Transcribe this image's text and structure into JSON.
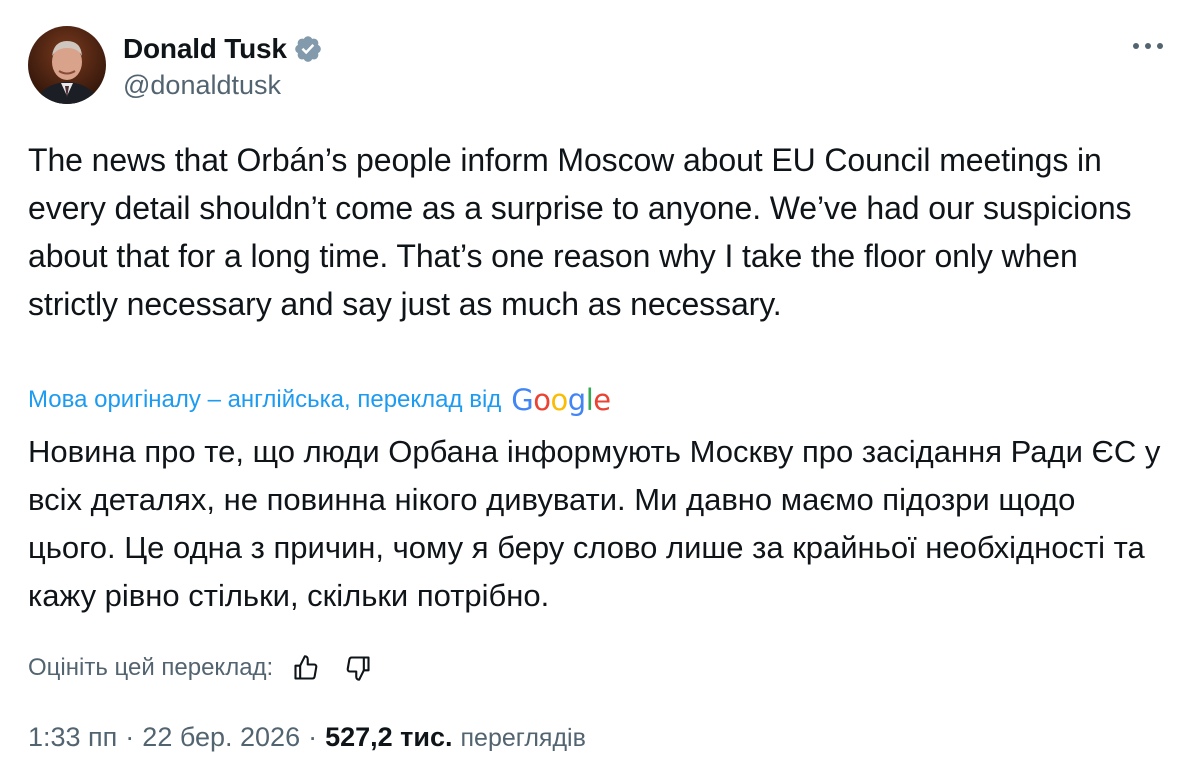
{
  "author": {
    "display_name": "Donald Tusk",
    "handle": "@donaldtusk",
    "verified": true
  },
  "icons": {
    "verified": "verified-badge-icon",
    "more": "more-options-icon",
    "like_translation": "thumbs-up-icon",
    "dislike_translation": "thumbs-down-icon"
  },
  "tweet": {
    "text": "The news that Orbán’s people inform Moscow about EU Council meetings in every detail shouldn’t come as a surprise to anyone. We’ve had our suspicions about that for a long time. That’s one reason why I take the floor only when strictly necessary and say just as much as necessary."
  },
  "translation": {
    "label": "Мова оригіналу – англійська, переклад від",
    "provider_logo": "Google",
    "text": "Новина про те, що люди Орбана інформують Москву про засідання Ради ЄС у всіх деталях, не повинна нікого дивувати. Ми давно маємо підозри щодо цього. Це одна з причин, чому я беру слово лише за крайньої необхідності та кажу рівно стільки, скільки потрібно.",
    "rate_label": "Оцініть цей переклад:"
  },
  "meta": {
    "time": "1:33 пп",
    "separator": "·",
    "date": "22 бер. 2026",
    "views_count": "527,2 тис.",
    "views_label": "переглядів"
  },
  "colors": {
    "text": "#0f1419",
    "secondary": "#536471",
    "link": "#1d9bf0",
    "verified": "#829aab"
  }
}
